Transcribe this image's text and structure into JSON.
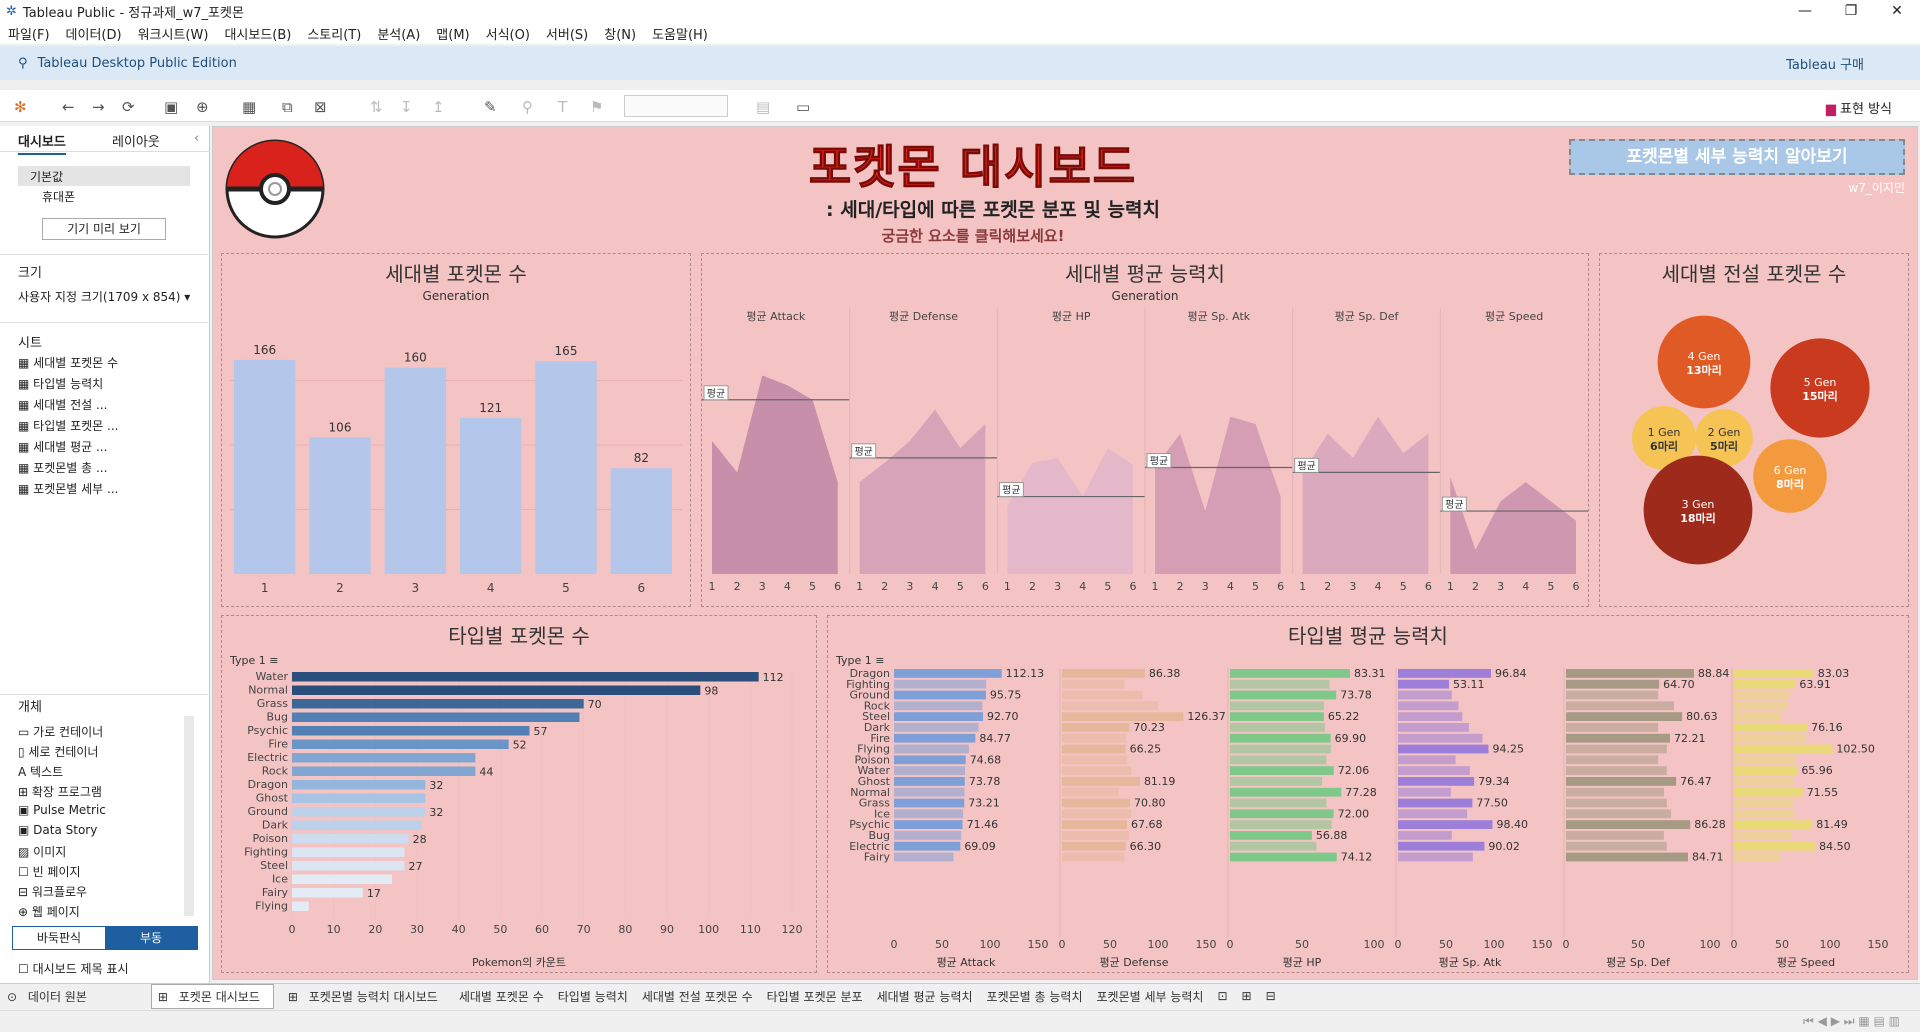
{
  "window": {
    "title": "Tableau Public - 정규과제_w7_포켓몬"
  },
  "menu": [
    "파일(F)",
    "데이터(D)",
    "워크시트(W)",
    "대시보드(B)",
    "스토리(T)",
    "분석(A)",
    "맵(M)",
    "서식(O)",
    "서버(S)",
    "창(N)",
    "도움말(H)"
  ],
  "infobar": {
    "edition": "Tableau Desktop Public Edition",
    "buy": "Tableau 구매"
  },
  "toolbar": {
    "present": "표현 방식"
  },
  "sidebar": {
    "tab_dashboard": "대시보드",
    "tab_layout": "레이아웃",
    "device_default": "기본값",
    "device_phone": "휴대폰",
    "preview_button": "기기 미리 보기",
    "size_label": "크기",
    "size_value": "사용자 지정 크기(1709 x 854)",
    "sheets_label": "시트",
    "sheets": [
      "세대별 포켓몬 수",
      "타입별 능력치",
      "세대별 전설 ...",
      "타입별 포켓몬 ...",
      "세대별 평균 ...",
      "포켓몬별 총 ...",
      "포켓몬별 세부 ..."
    ],
    "objects_label": "개체",
    "objects": [
      "가로 컨테이너",
      "세로 컨테이너",
      "텍스트",
      "확장 프로그램",
      "Pulse Metric",
      "Data Story",
      "이미지",
      "빈 페이지",
      "워크플로우",
      "웹 페이지"
    ],
    "tiled": "바둑판식",
    "floating": "부동",
    "show_title": "대시보드 제목 표시"
  },
  "dashboard": {
    "title": "포켓몬 대시보드",
    "subtitle": ": 세대/타입에 따른 포켓몬 분포 및 능력치",
    "hint": "궁금한 요소를 클릭해보세요!",
    "detail_button": "포켓몬별 세부 능력치 알아보기",
    "author": "w7_이지민",
    "panel1_title": "세대별 포켓몬 수",
    "panel2_title": "세대별 평균 능력치",
    "panel3_title": "세대별 전설 포켓몬 수",
    "panel4_title": "타입별 포켓몬 수",
    "panel5_title": "타입별 평균 능력치",
    "gen_header": "Generation",
    "type_header": "Type 1",
    "avg_label": "평균",
    "count_axis": "Pokemon의 카운트"
  },
  "chart_data": [
    {
      "type": "bar",
      "title": "세대별 포켓몬 수",
      "xlabel": "Generation",
      "categories": [
        "1",
        "2",
        "3",
        "4",
        "5",
        "6"
      ],
      "values": [
        166,
        106,
        160,
        121,
        165,
        82
      ],
      "ylim": [
        0,
        200
      ],
      "grid": true
    },
    {
      "type": "area",
      "title": "세대별 평균 능력치",
      "xlabel": "Generation",
      "panels": [
        {
          "name": "평균 Attack",
          "avg_y": 0.72,
          "values": [
            0.55,
            0.42,
            0.82,
            0.78,
            0.72,
            0.38
          ]
        },
        {
          "name": "평균 Defense",
          "avg_y": 0.48,
          "values": [
            0.38,
            0.46,
            0.55,
            0.68,
            0.52,
            0.62
          ]
        },
        {
          "name": "평균 HP",
          "avg_y": 0.32,
          "values": [
            0.28,
            0.46,
            0.48,
            0.32,
            0.52,
            0.45
          ]
        },
        {
          "name": "평균 Sp. Atk",
          "avg_y": 0.44,
          "values": [
            0.44,
            0.58,
            0.26,
            0.65,
            0.62,
            0.32
          ]
        },
        {
          "name": "평균 Sp. Def",
          "avg_y": 0.42,
          "values": [
            0.42,
            0.58,
            0.48,
            0.65,
            0.5,
            0.58
          ]
        },
        {
          "name": "평균 Speed",
          "avg_y": 0.26,
          "values": [
            0.4,
            0.1,
            0.3,
            0.38,
            0.3,
            0.22
          ]
        }
      ]
    },
    {
      "type": "bubble",
      "title": "세대별 전설 포켓몬 수",
      "items": [
        {
          "label": "4 Gen",
          "value_label": "13마리",
          "value": 13,
          "color": "#e05a25"
        },
        {
          "label": "5 Gen",
          "value_label": "15마리",
          "value": 15,
          "color": "#c93a1e"
        },
        {
          "label": "1 Gen",
          "value_label": "6마리",
          "value": 6,
          "color": "#f5c455"
        },
        {
          "label": "2 Gen",
          "value_label": "5마리",
          "value": 5,
          "color": "#f5c455"
        },
        {
          "label": "6 Gen",
          "value_label": "8마리",
          "value": 8,
          "color": "#f49a3e"
        },
        {
          "label": "3 Gen",
          "value_label": "18마리",
          "value": 18,
          "color": "#9e2a1b"
        }
      ]
    },
    {
      "type": "bar",
      "title": "타입별 포켓몬 수",
      "orientation": "horizontal",
      "xlabel": "Pokemon의 카운트",
      "ylabel": "Type 1",
      "categories": [
        "Water",
        "Normal",
        "Grass",
        "Bug",
        "Psychic",
        "Fire",
        "Electric",
        "Rock",
        "Dragon",
        "Ghost",
        "Ground",
        "Dark",
        "Poison",
        "Fighting",
        "Steel",
        "Ice",
        "Fairy",
        "Flying"
      ],
      "values": [
        112,
        98,
        70,
        69,
        57,
        52,
        44,
        44,
        32,
        32,
        32,
        31,
        28,
        27,
        27,
        24,
        17,
        4
      ],
      "labels": [
        "112",
        "98",
        "70",
        "",
        "57",
        "52",
        "",
        "44",
        "32",
        "",
        "32",
        "",
        "28",
        "",
        "27",
        "",
        "17",
        ""
      ],
      "xlim": [
        0,
        120
      ],
      "ticks": [
        0,
        10,
        20,
        30,
        40,
        50,
        60,
        70,
        80,
        90,
        100,
        110,
        120
      ]
    },
    {
      "type": "bar",
      "title": "타입별 평균 능력치",
      "orientation": "horizontal",
      "ylabel": "Type 1",
      "categories": [
        "Dragon",
        "Fighting",
        "Ground",
        "Rock",
        "Steel",
        "Dark",
        "Fire",
        "Flying",
        "Poison",
        "Water",
        "Ghost",
        "Normal",
        "Grass",
        "Ice",
        "Psychic",
        "Bug",
        "Electric",
        "Fairy"
      ],
      "series": [
        {
          "name": "평균 Attack",
          "color": "#7e9fd8",
          "max": 150,
          "ticks": [
            0,
            50,
            100,
            150
          ],
          "values": [
            112.13,
            96,
            95.75,
            92,
            92.7,
            88,
            84.77,
            78,
            74.68,
            74,
            73.78,
            73.5,
            73.21,
            72,
            71.46,
            70,
            69.09,
            62
          ],
          "labels": [
            "112.13",
            "",
            "95.75",
            "",
            "92.70",
            "",
            "84.77",
            "",
            "74.68",
            "",
            "73.78",
            "",
            "73.21",
            "",
            "71.46",
            "",
            "69.09",
            ""
          ]
        },
        {
          "name": "평균 Defense",
          "color": "#e6b79a",
          "max": 150,
          "ticks": [
            0,
            50,
            100,
            150
          ],
          "values": [
            86.38,
            65,
            84,
            100,
            126.37,
            70.23,
            67,
            66.25,
            68,
            72,
            81.19,
            59,
            70.8,
            72,
            67.68,
            70,
            66.3,
            65
          ],
          "labels": [
            "86.38",
            "",
            "",
            "",
            "126.37",
            "70.23",
            "",
            "66.25",
            "",
            "",
            "81.19",
            "",
            "70.80",
            "",
            "67.68",
            "",
            "66.30",
            ""
          ]
        },
        {
          "name": "평균 HP",
          "color": "#7ec98a",
          "max": 100,
          "ticks": [
            0,
            50,
            100
          ],
          "values": [
            83.31,
            69,
            73.78,
            65.22,
            65.22,
            66,
            69.9,
            70,
            67,
            72.06,
            64,
            77.28,
            67,
            72,
            70.63,
            56.88,
            60,
            74.12
          ],
          "labels": [
            "83.31",
            "",
            "73.78",
            "",
            "65.22",
            "",
            "69.90",
            "",
            "",
            "72.06",
            "",
            "77.28",
            "",
            "72.00",
            "",
            "56.88",
            "",
            "74.12"
          ]
        },
        {
          "name": "평균 Sp. Atk",
          "color": "#9d7ed8",
          "max": 150,
          "ticks": [
            0,
            50,
            100,
            150
          ],
          "values": [
            96.84,
            53.11,
            56,
            63,
            67,
            74,
            88,
            94.25,
            60,
            74.8,
            79.34,
            55,
            77.5,
            72,
            98.4,
            56,
            90.02,
            78
          ],
          "labels": [
            "96.84",
            "53.11",
            "",
            "",
            "",
            "",
            "",
            "94.25",
            "",
            "",
            "79.34",
            "",
            "77.50",
            "",
            "98.40",
            "",
            "90.02",
            ""
          ]
        },
        {
          "name": "평균 Sp. Def",
          "color": "#a79a85",
          "max": 100,
          "ticks": [
            0,
            50,
            100
          ],
          "values": [
            88.84,
            64.7,
            64,
            75,
            80.63,
            64,
            72.21,
            70,
            64,
            70,
            76.47,
            68,
            70,
            73,
            86.28,
            68,
            70,
            84.71
          ],
          "labels": [
            "88.84",
            "64.70",
            "",
            "",
            "80.63",
            "",
            "72.21",
            "",
            "",
            "",
            "76.47",
            "",
            "",
            "",
            "86.28",
            "",
            "",
            "84.71"
          ]
        },
        {
          "name": "평균 Speed",
          "color": "#e8d878",
          "max": 150,
          "ticks": [
            0,
            50,
            100,
            150
          ],
          "values": [
            83.03,
            63.91,
            58,
            55,
            49,
            76.16,
            74,
            102.5,
            64,
            65.96,
            62,
            71.55,
            61,
            63,
            81.49,
            60,
            84.5,
            48
          ],
          "labels": [
            "83.03",
            "63.91",
            "",
            "",
            "",
            "76.16",
            "",
            "102.50",
            "",
            "65.96",
            "",
            "71.55",
            "",
            "",
            "81.49",
            "",
            "84.50",
            ""
          ]
        }
      ]
    }
  ],
  "bottom_tabs": [
    "데이터 원본",
    "포켓몬 대시보드",
    "포켓몬별 능력치 대시보드",
    "세대별 포켓몬 수",
    "타입별 능력치",
    "세대별 전설 포켓몬 수",
    "타입별 포켓몬 분포",
    "세대별 평균 능력치",
    "포켓몬별 총 능력치",
    "포켓몬별 세부 능력치"
  ]
}
